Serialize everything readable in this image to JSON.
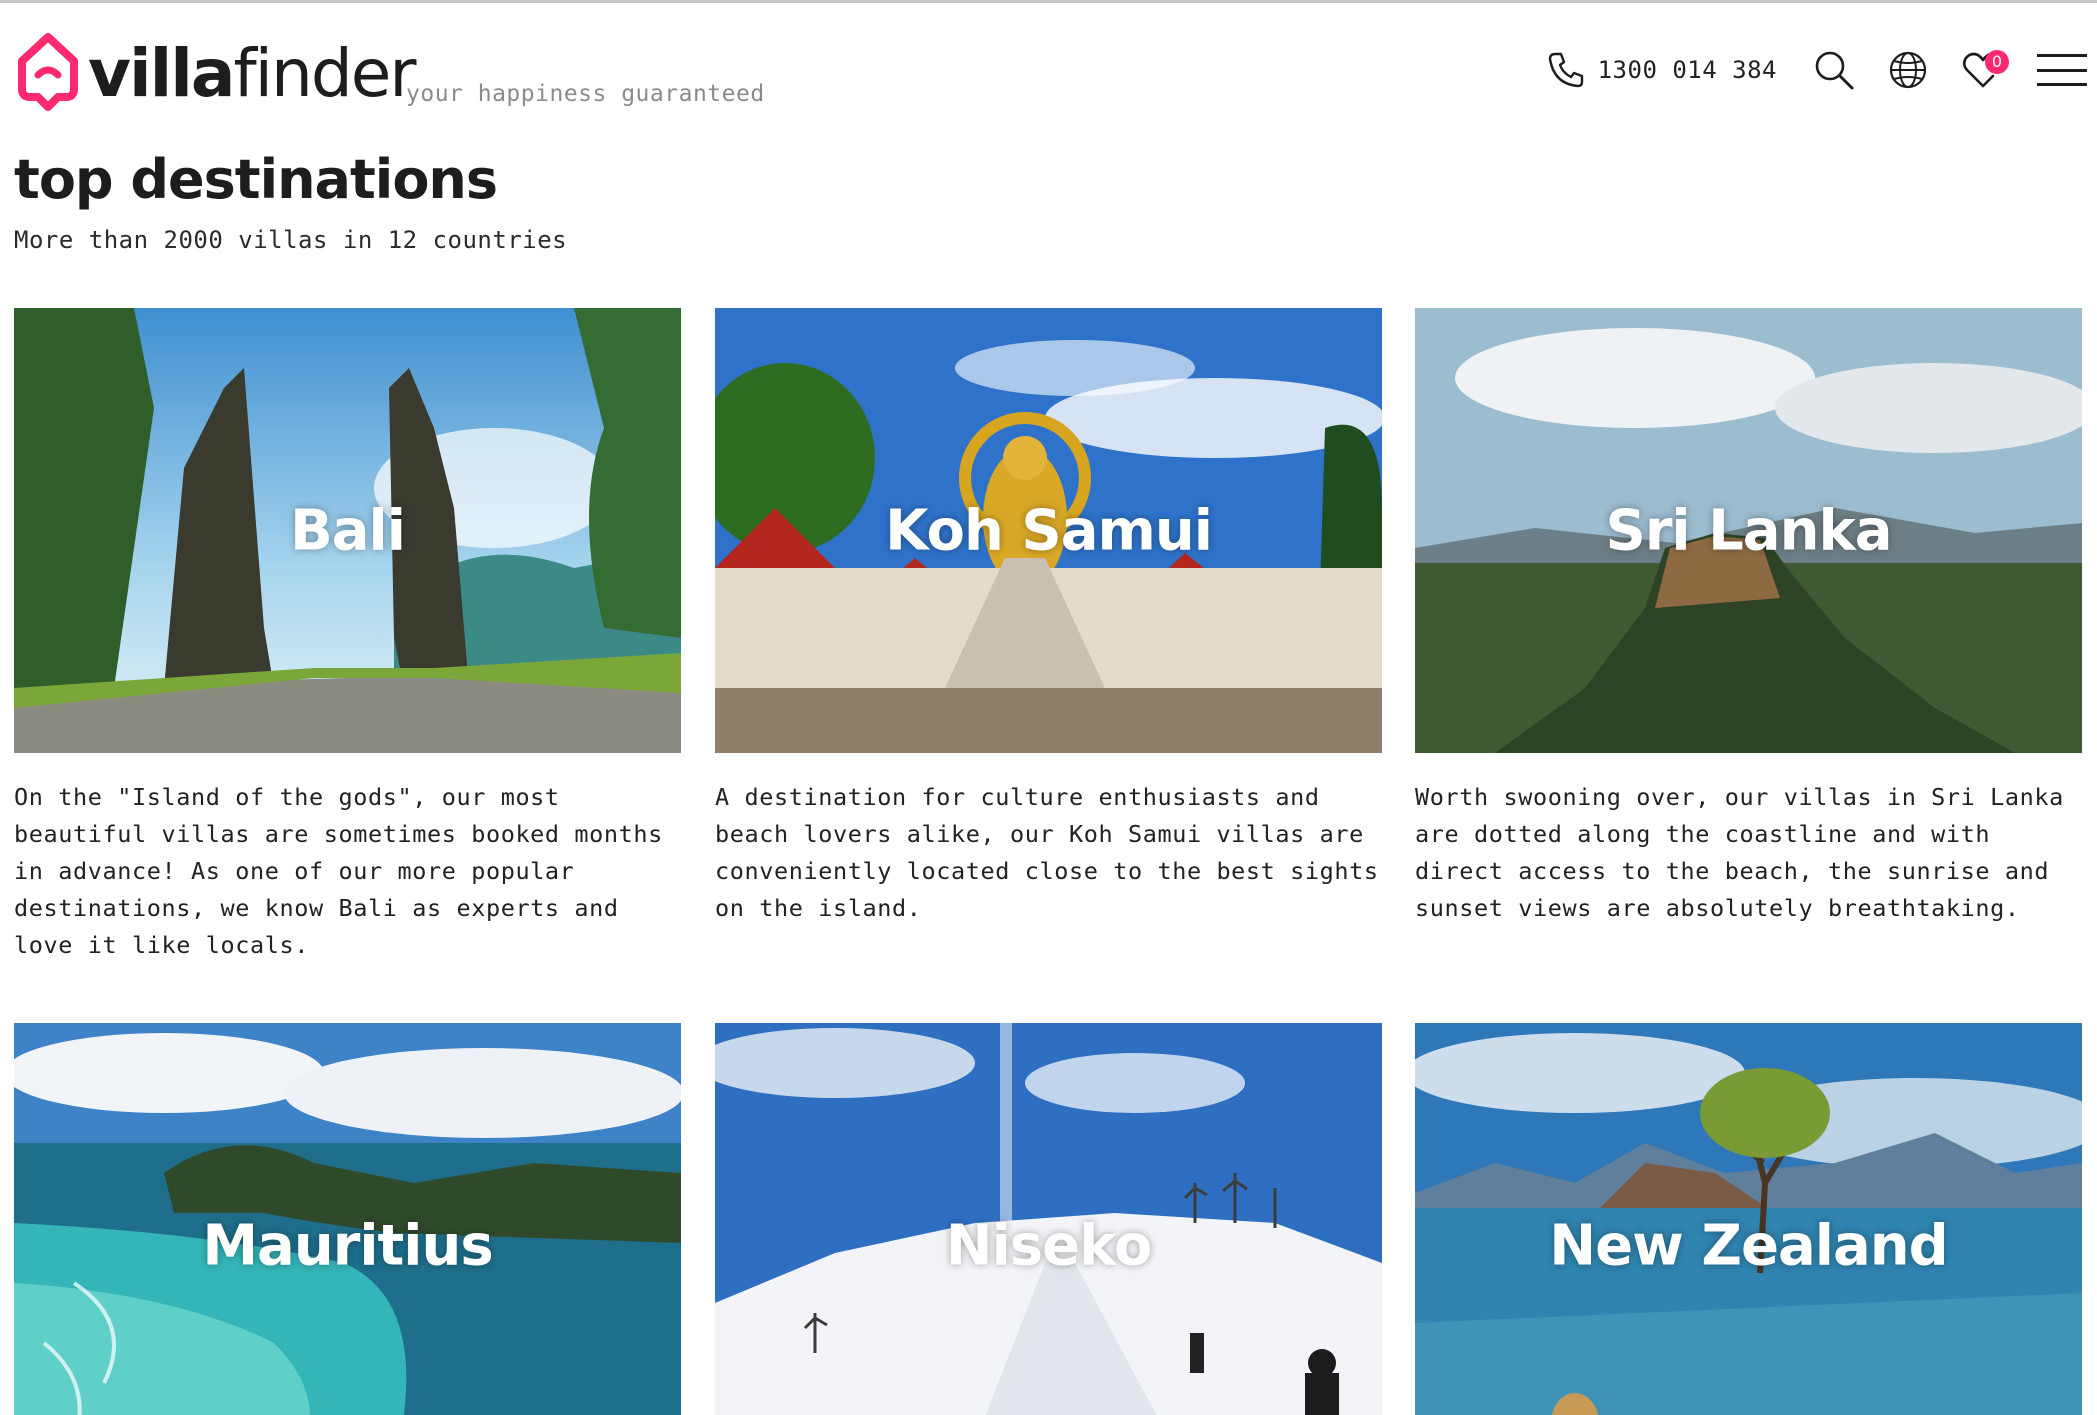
{
  "header": {
    "logo_bold": "villa",
    "logo_light": "finder",
    "tagline": "your happiness guaranteed",
    "phone": "1300 014 384",
    "favorites_count": "0",
    "icons": [
      "phone-icon",
      "search-icon",
      "globe-icon",
      "heart-icon",
      "menu-icon"
    ],
    "brand_color": "#ff2a6d"
  },
  "page": {
    "title": "top destinations",
    "subtitle": "More than 2000 villas in 12 countries"
  },
  "destinations": [
    {
      "name": "Bali",
      "description": "On the \"Island of the gods\", our most beautiful villas are sometimes booked months in advance! As one of our more popular destinations, we know Bali as experts and love it like locals."
    },
    {
      "name": "Koh Samui",
      "description": "A destination for culture enthusiasts and beach lovers alike, our Koh Samui villas are conveniently located close to the best sights on the island."
    },
    {
      "name": "Sri Lanka",
      "description": "Worth swooning over, our villas in Sri Lanka are dotted along the coastline and with direct access to the beach, the sunrise and sunset views are absolutely breathtaking."
    },
    {
      "name": "Mauritius",
      "description": ""
    },
    {
      "name": "Niseko",
      "description": ""
    },
    {
      "name": "New Zealand",
      "description": ""
    }
  ]
}
